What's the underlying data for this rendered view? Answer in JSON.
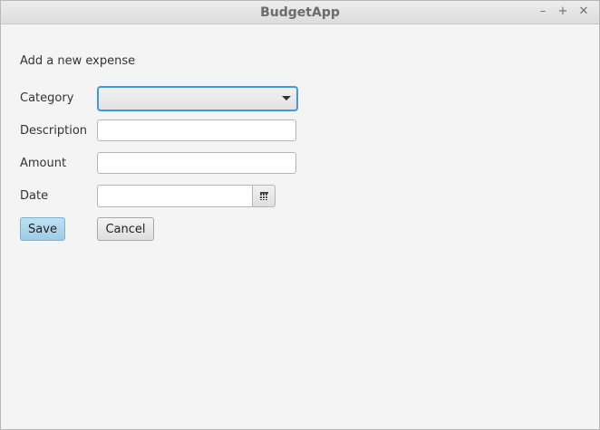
{
  "window": {
    "title": "BudgetApp",
    "controls": {
      "minimize": "–",
      "maximize": "+",
      "close": "✕"
    }
  },
  "form": {
    "heading": "Add a new expense",
    "category": {
      "label": "Category",
      "value": ""
    },
    "description": {
      "label": "Description",
      "value": "",
      "placeholder": ""
    },
    "amount": {
      "label": "Amount",
      "value": "",
      "placeholder": ""
    },
    "date": {
      "label": "Date",
      "value": "",
      "placeholder": "",
      "picker_icon": "calendar-icon"
    },
    "save_label": "Save",
    "cancel_label": "Cancel"
  },
  "colors": {
    "focus_accent": "#3a9be0",
    "default_button": "#a9d3ec",
    "background": "#f4f4f4"
  }
}
